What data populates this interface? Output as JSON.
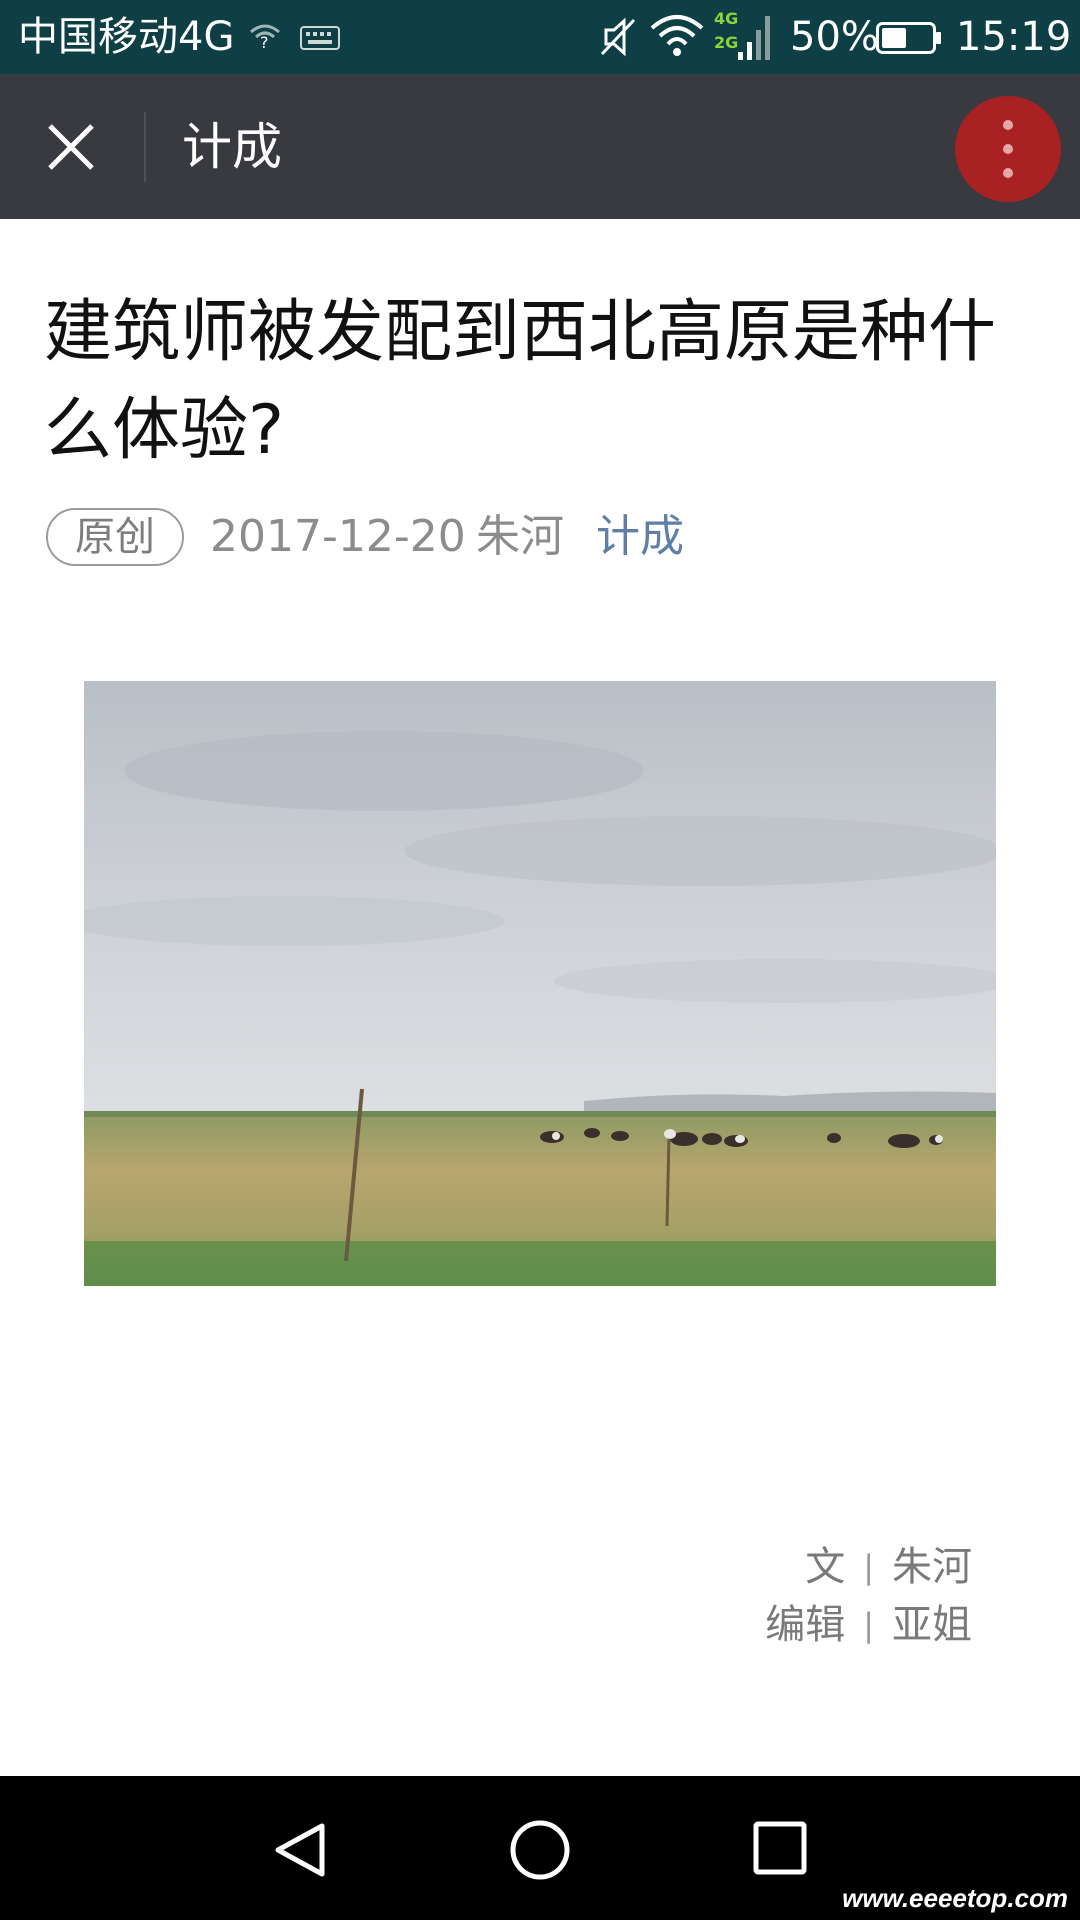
{
  "status_bar": {
    "carrier": "中国移动4G",
    "network_labels": [
      "4G",
      "2G"
    ],
    "battery_percent": "50%",
    "battery_level": 0.5,
    "time": "15:19"
  },
  "toolbar": {
    "title": "计成",
    "close_icon": "close-icon",
    "more_icon": "more-vertical-icon",
    "more_button_color": "#a82224"
  },
  "article": {
    "title": "建筑师被发配到西北高原是种什么体验?",
    "badge": "原创",
    "date": "2017-12-20",
    "author": "朱河",
    "account": "计成",
    "account_color": "#607fa6",
    "credits": [
      {
        "role": "文",
        "separator": "|",
        "name": "朱河"
      },
      {
        "role": "编辑",
        "separator": "|",
        "name": "亚姐"
      }
    ]
  },
  "nav_bar": {
    "back_icon": "back-triangle-icon",
    "home_icon": "home-circle-icon",
    "recent_icon": "recent-apps-icon"
  },
  "watermark": "www.eeeetop.com"
}
